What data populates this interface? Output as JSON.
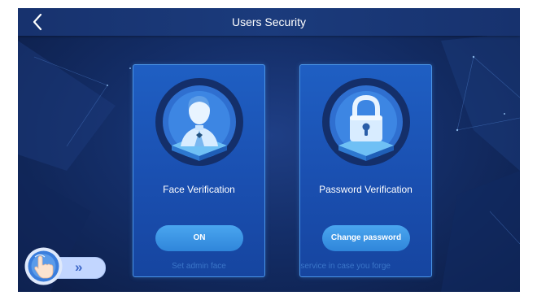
{
  "header": {
    "title": "Users Security",
    "back_icon": "chevron-left-icon"
  },
  "cards": [
    {
      "title": "Face Verification",
      "icon": "face-user-icon",
      "button_label": "ON",
      "hint": "Set admin face"
    },
    {
      "title": "Password Verification",
      "icon": "padlock-icon",
      "button_label": "Change password",
      "hint": "tomer service in case you forge"
    }
  ],
  "floating_assistant": {
    "icon": "touch-hand-icon",
    "expand_glyph": "»"
  },
  "colors": {
    "background": "#142e68",
    "card": "#1a4fb0",
    "card_border": "#4a94e6",
    "button": "#3a93e4",
    "hint_text": "#3a75c8"
  }
}
